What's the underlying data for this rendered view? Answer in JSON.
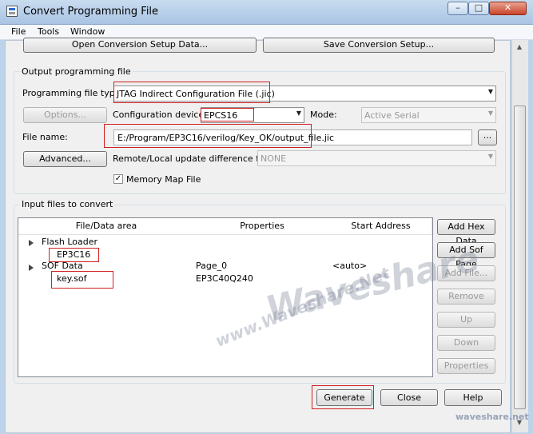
{
  "window": {
    "title": "Convert Programming File"
  },
  "menu": [
    "File",
    "Tools",
    "Window"
  ],
  "toolbar": {
    "open_setup": "Open Conversion Setup Data...",
    "save_setup": "Save Conversion Setup..."
  },
  "output": {
    "group_title": "Output programming file",
    "file_type_label": "Programming file type:",
    "file_type_value": "JTAG Indirect Configuration File (.jic)",
    "options_button": "Options...",
    "config_device_label": "Configuration device:",
    "config_device_value": "EPCS16",
    "mode_label": "Mode:",
    "mode_value": "Active Serial",
    "file_name_label": "File name:",
    "file_name_value": "E:/Program/EP3C16/verilog/Key_OK/output_file.jic",
    "browse_button": "...",
    "advanced_button": "Advanced...",
    "remote_label": "Remote/Local update difference file:",
    "remote_value": "NONE",
    "memory_map_label": "Memory Map File",
    "memory_map_checked": true
  },
  "input": {
    "group_title": "Input files to convert",
    "columns": [
      "File/Data area",
      "Properties",
      "Start Address"
    ],
    "rows": {
      "flash_loader": "Flash Loader",
      "flash_device": "EP3C16",
      "sof_data": "SOF Data",
      "sof_properties": "Page_0",
      "sof_address": "<auto>",
      "sof_file": "key.sof",
      "sof_file_properties": "EP3C40Q240"
    },
    "side_buttons": {
      "add_hex": "Add Hex Data",
      "add_sof": "Add Sof Page",
      "add_file": "Add File...",
      "remove": "Remove",
      "up": "Up",
      "down": "Down",
      "properties": "Properties"
    }
  },
  "footer": {
    "generate": "Generate",
    "close": "Close",
    "help": "Help"
  },
  "watermark": {
    "main": "Waveshare",
    "url": "www.Waveshare.Net",
    "corner": "waveshare.net"
  },
  "colors": {
    "highlight": "#d21f1f",
    "title_bar": "#b8cfea"
  }
}
